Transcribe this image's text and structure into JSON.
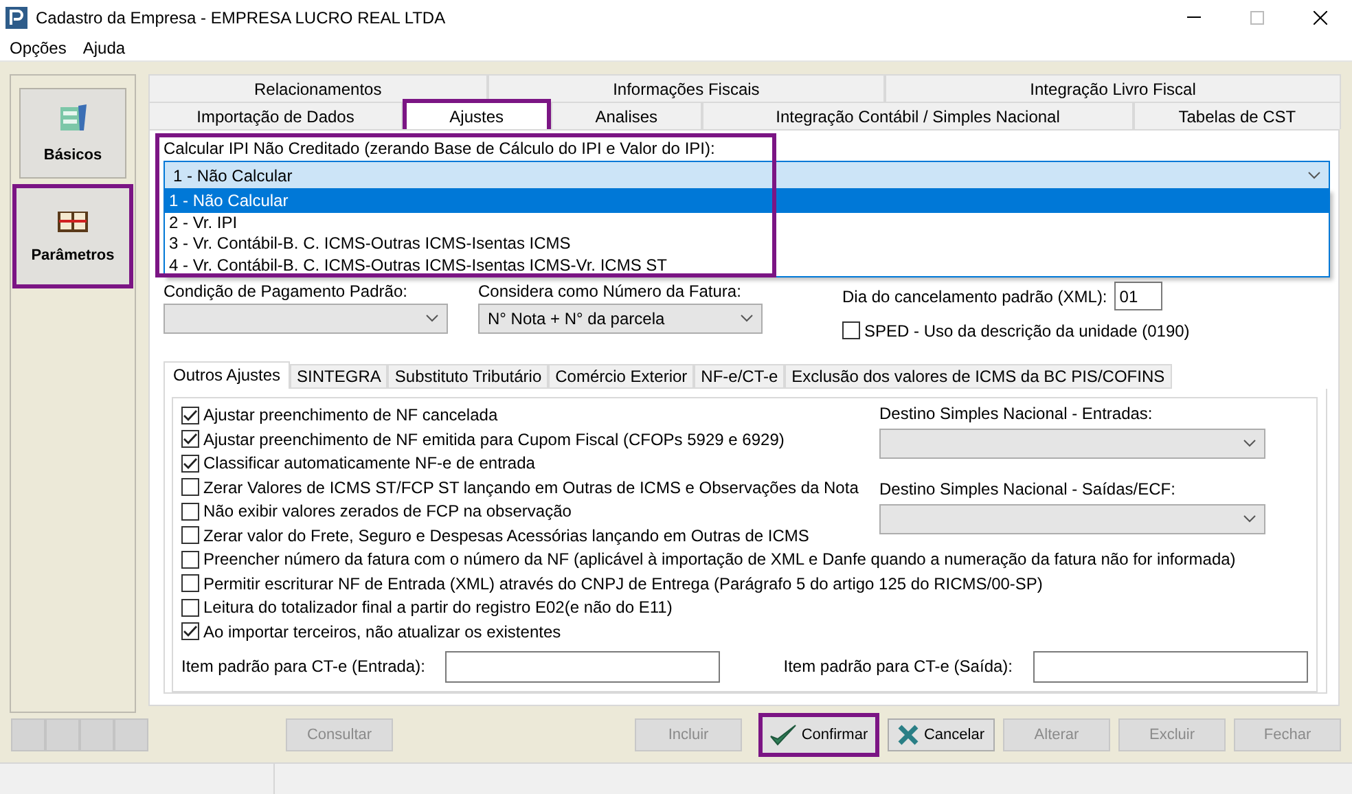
{
  "window": {
    "title": "Cadastro da Empresa - EMPRESA LUCRO REAL LTDA"
  },
  "menu": [
    "Opções",
    "Ajuda"
  ],
  "sidebar": [
    {
      "label": "Básicos",
      "kind": "cabinet",
      "highlighted": false
    },
    {
      "label": "Parâmetros",
      "kind": "book",
      "highlighted": true
    }
  ],
  "tab_rows": [
    [
      {
        "label": "Relacionamentos",
        "selected": false,
        "highlighted": false
      },
      {
        "label": "Informações Fiscais",
        "selected": false,
        "highlighted": false
      },
      {
        "label": "Integração Livro Fiscal",
        "selected": false,
        "highlighted": false
      }
    ],
    [
      {
        "label": "Importação de Dados",
        "selected": false,
        "highlighted": false
      },
      {
        "label": "Ajustes",
        "selected": true,
        "highlighted": true
      },
      {
        "label": "Analises",
        "selected": false,
        "highlighted": false
      },
      {
        "label": "Integração Contábil / Simples Nacional",
        "selected": false,
        "highlighted": false
      },
      {
        "label": "Tabelas de CST",
        "selected": false,
        "highlighted": false
      }
    ]
  ],
  "ipi": {
    "label": "Calcular IPI Não Creditado (zerando Base de Cálculo do IPI e Valor do IPI):",
    "value": "1 - Não Calcular",
    "expanded": true,
    "highlighted": true,
    "options": [
      {
        "label": "1 - Não Calcular",
        "selected": true
      },
      {
        "label": "2 - Vr. IPI",
        "selected": false
      },
      {
        "label": "3 - Vr. Contábil-B. C. ICMS-Outras ICMS-Isentas ICMS",
        "selected": false
      },
      {
        "label": "4 - Vr. Contábil-B. C. ICMS-Outras ICMS-Isentas ICMS-Vr. ICMS ST",
        "selected": false
      }
    ]
  },
  "payment_condition": {
    "label": "Condição de Pagamento Padrão:"
  },
  "invoice_number": {
    "label": "Considera como Número da Fatura:",
    "value": "N° Nota + N° da parcela"
  },
  "cancel_day": {
    "label": "Dia do cancelamento padrão (XML):",
    "value": "01"
  },
  "sped": {
    "label": "SPED - Uso da descrição da unidade (0190)",
    "checked": false
  },
  "sub_tabs": [
    {
      "label": "Outros Ajustes",
      "selected": true
    },
    {
      "label": "SINTEGRA",
      "selected": false
    },
    {
      "label": "Substituto Tributário",
      "selected": false
    },
    {
      "label": "Comércio Exterior",
      "selected": false
    },
    {
      "label": "NF-e/CT-e",
      "selected": false
    },
    {
      "label": "Exclusão dos valores de ICMS da BC PIS/COFINS",
      "selected": false
    }
  ],
  "options": [
    {
      "label": "Ajustar preenchimento de NF cancelada",
      "checked": true
    },
    {
      "label": "Ajustar preenchimento de NF emitida para Cupom Fiscal (CFOPs 5929 e 6929)",
      "checked": true
    },
    {
      "label": "Classificar automaticamente NF-e de entrada",
      "checked": true
    },
    {
      "label": "Zerar Valores de ICMS ST/FCP ST lançando em Outras de ICMS e Observações da Nota",
      "checked": false
    },
    {
      "label": "Não exibir valores zerados de FCP na observação",
      "checked": false
    },
    {
      "label": "Zerar valor do Frete, Seguro e Despesas Acessórias lançando em Outras de ICMS",
      "checked": false
    },
    {
      "label": "Preencher número da fatura com o número da NF (aplicável à importação de XML e Danfe quando a numeração da fatura não for informada)",
      "checked": false
    },
    {
      "label": "Permitir escriturar NF de Entrada (XML) através do CNPJ de Entrega (Parágrafo 5 do artigo 125 do RICMS/00-SP)",
      "checked": false
    },
    {
      "label": "Leitura do totalizador final a partir do registro E02(e não do E11)",
      "checked": false
    },
    {
      "label": "Ao importar terceiros, não atualizar os existentes",
      "checked": true
    }
  ],
  "destinations": [
    {
      "label": "Destino Simples Nacional - Entradas:"
    },
    {
      "label": "Destino Simples Nacional - Saídas/ECF:"
    }
  ],
  "item_fields": [
    {
      "label": "Item padrão para CT-e (Entrada):"
    },
    {
      "label": "Item padrão para CT-e (Saída):"
    }
  ],
  "nav_buttons": [
    {
      "disabled": true
    },
    {
      "disabled": true
    },
    {
      "disabled": true
    },
    {
      "disabled": true
    }
  ],
  "buttons": [
    {
      "label": "Consultar",
      "kind": "plain",
      "disabled": true,
      "highlighted": false
    },
    {
      "label": "Incluir",
      "kind": "plain",
      "disabled": true,
      "highlighted": false
    },
    {
      "label": "Confirmar",
      "kind": "check",
      "disabled": false,
      "highlighted": true
    },
    {
      "label": "Cancelar",
      "kind": "cross",
      "disabled": false,
      "highlighted": false
    },
    {
      "label": "Alterar",
      "kind": "plain",
      "disabled": true,
      "highlighted": false
    },
    {
      "label": "Excluir",
      "kind": "plain",
      "disabled": true,
      "highlighted": false
    },
    {
      "label": "Fechar",
      "kind": "plain",
      "disabled": true,
      "highlighted": false
    }
  ]
}
